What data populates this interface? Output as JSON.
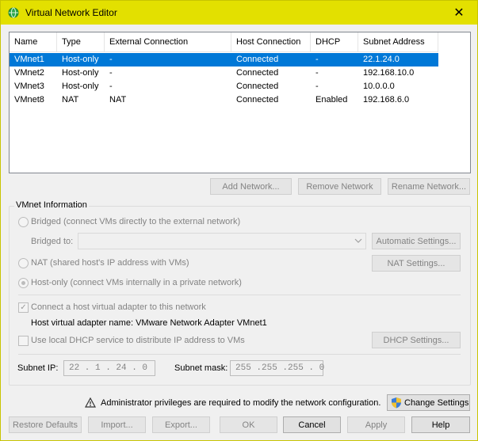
{
  "window": {
    "title": "Virtual Network Editor",
    "close_glyph": "✕"
  },
  "network_table": {
    "columns": [
      "Name",
      "Type",
      "External Connection",
      "Host Connection",
      "DHCP",
      "Subnet Address"
    ],
    "rows": [
      [
        "VMnet1",
        "Host-only",
        "-",
        "Connected",
        "-",
        "22.1.24.0"
      ],
      [
        "VMnet2",
        "Host-only",
        "-",
        "Connected",
        "-",
        "192.168.10.0"
      ],
      [
        "VMnet3",
        "Host-only",
        "-",
        "Connected",
        "-",
        "10.0.0.0"
      ],
      [
        "VMnet8",
        "NAT",
        "NAT",
        "Connected",
        "Enabled",
        "192.168.6.0"
      ]
    ],
    "selected_row": 0
  },
  "network_buttons": {
    "add": "Add Network...",
    "remove": "Remove Network",
    "rename": "Rename Network..."
  },
  "vmnet_info": {
    "group_title": "VMnet Information",
    "bridged_label": "Bridged (connect VMs directly to the external network)",
    "bridged_to_label": "Bridged to:",
    "automatic_settings": "Automatic Settings...",
    "nat_label": "NAT (shared host's IP address with VMs)",
    "nat_settings": "NAT Settings...",
    "hostonly_label": "Host-only (connect VMs internally in a private network)",
    "connect_adapter_label": "Connect a host virtual adapter to this network",
    "adapter_name_text": "Host virtual adapter name: VMware Network Adapter VMnet1",
    "dhcp_label": "Use local DHCP service to distribute IP address to VMs",
    "dhcp_settings": "DHCP Settings...",
    "subnet_ip_label": "Subnet IP:",
    "subnet_ip_value": "22 . 1 . 24 . 0",
    "subnet_mask_label": "Subnet mask:",
    "subnet_mask_value": "255 .255 .255 . 0",
    "selected_mode": "host-only",
    "connect_adapter_checked": true,
    "dhcp_checked": false
  },
  "admin_notice": {
    "text": "Administrator privileges are required to modify the network configuration.",
    "change_settings": "Change Settings"
  },
  "footer": {
    "restore": "Restore Defaults",
    "import": "Import...",
    "export": "Export...",
    "ok": "OK",
    "cancel": "Cancel",
    "apply": "Apply",
    "help": "Help"
  },
  "colors": {
    "title_bar": "#e3e000",
    "selection": "#0078d7",
    "accent_icon": "#1a9e3e"
  }
}
